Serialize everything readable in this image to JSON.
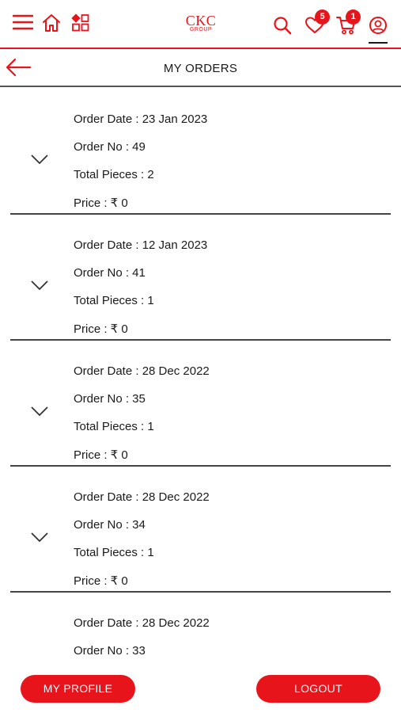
{
  "header": {
    "logo_main": "CKC",
    "logo_sub": "GROUP",
    "wishlist_count": "5",
    "cart_count": "1",
    "icons": [
      "menu-icon",
      "home-icon",
      "categories-icon",
      "search-icon",
      "wishlist-icon",
      "cart-icon",
      "account-icon"
    ],
    "accent_color": "#e8141c"
  },
  "page": {
    "title": "MY ORDERS"
  },
  "orders": [
    {
      "date": "Order Date : 23 Jan 2023",
      "number": "Order No : 49",
      "pieces": "Total Pieces : 2",
      "price": "Price : ₹ 0"
    },
    {
      "date": "Order Date : 12 Jan 2023",
      "number": "Order No : 41",
      "pieces": "Total Pieces : 1",
      "price": "Price : ₹ 0"
    },
    {
      "date": "Order Date : 28 Dec 2022",
      "number": "Order No : 35",
      "pieces": "Total Pieces : 1",
      "price": "Price : ₹ 0"
    },
    {
      "date": "Order Date : 28 Dec 2022",
      "number": "Order No : 34",
      "pieces": "Total Pieces : 1",
      "price": "Price : ₹ 0"
    },
    {
      "date": "Order Date : 28 Dec 2022",
      "number": "Order No : 33",
      "pieces": "",
      "price": ""
    }
  ],
  "footer": {
    "profile_label": "MY PROFILE",
    "logout_label": "LOGOUT"
  }
}
